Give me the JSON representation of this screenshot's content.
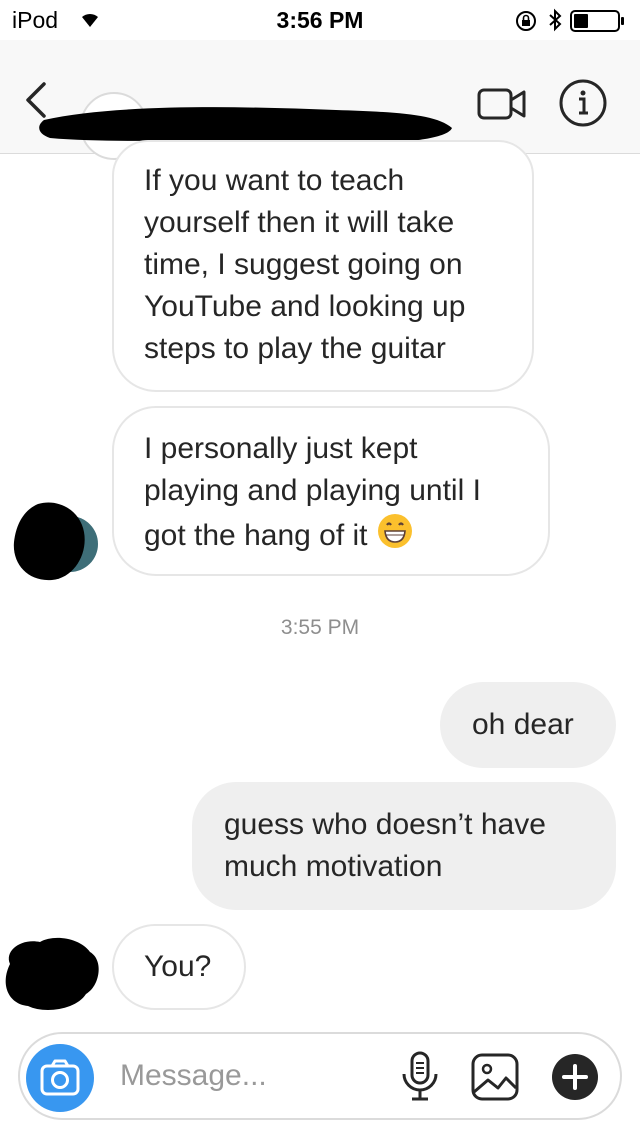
{
  "status_bar": {
    "carrier": "iPod",
    "time": "3:56 PM"
  },
  "header": {
    "username": "redacted"
  },
  "messages": [
    {
      "direction": "incoming",
      "lines": [
        "If you want to teach",
        "yourself then it will take",
        "time, I suggest going on",
        "YouTube and looking up",
        "steps to play the guitar"
      ]
    },
    {
      "direction": "incoming",
      "lines": [
        "I personally just kept",
        "playing and playing until I",
        "got the hang of it"
      ]
    },
    {
      "direction": "outgoing",
      "lines": [
        "oh dear"
      ]
    },
    {
      "direction": "outgoing",
      "lines": [
        "guess who doesn’t have",
        "much motivation"
      ]
    },
    {
      "direction": "incoming",
      "lines": [
        "You?"
      ]
    }
  ],
  "timestamp": "3:55 PM",
  "composer": {
    "placeholder": "Message..."
  },
  "icons": {
    "back": "chevron-left-icon",
    "video": "video-camera-icon",
    "info": "info-icon",
    "camera": "camera-icon",
    "mic": "microphone-icon",
    "gallery": "image-icon",
    "add": "plus-icon",
    "emoji": "grinning-face-emoji"
  },
  "colors": {
    "accent": "#3897f0",
    "outgoing_bubble": "#efefef",
    "incoming_border": "#e6e6e6"
  }
}
